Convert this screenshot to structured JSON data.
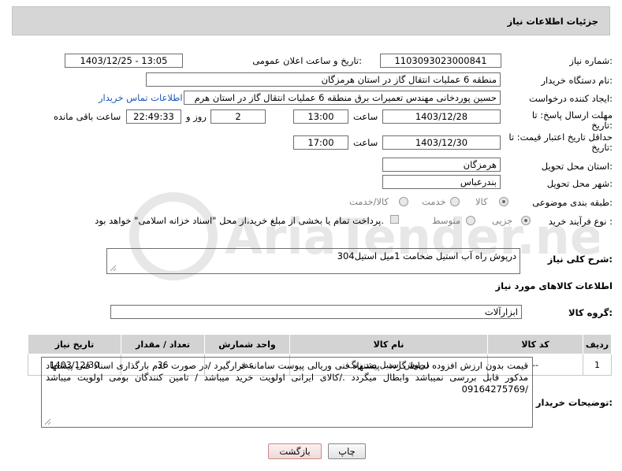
{
  "header": {
    "title": "جزئیات اطلاعات نیاز"
  },
  "form": {
    "need_number": {
      "label": "شماره نیاز:",
      "value": "1103093023000841"
    },
    "announce_datetime": {
      "label": "تاریخ و ساعت اعلان عمومی:",
      "value": "1403/12/25 - 13:05"
    },
    "buyer_org": {
      "label": "نام دستگاه خریدار:",
      "value": "منطقه 6 عملیات انتقال گاز در استان هرمزگان"
    },
    "requester": {
      "label": "ایجاد کننده درخواست:",
      "value": "حسین پوردخانی مهندس تعمیرات برق منطقه 6 عملیات انتقال گاز در استان هرم",
      "contact_link": "اطلاعات تماس خریدار"
    },
    "reply_deadline": {
      "label_line1": "مهلت ارسال پاسخ: تا",
      "label_line2": "تاریخ:",
      "date": "1403/12/28",
      "time_label": "ساعت",
      "time": "13:00",
      "days": "2",
      "days_label": "روز و",
      "remaining": "22:49:33",
      "remaining_label": "ساعت باقی مانده"
    },
    "validity_deadline": {
      "label_line1": "حداقل تاریخ اعتبار قیمت: تا",
      "label_line2": "تاریخ:",
      "date": "1403/12/30",
      "time_label": "ساعت",
      "time": "17:00"
    },
    "delivery_province": {
      "label": "استان محل تحویل:",
      "value": "هرمزگان"
    },
    "delivery_city": {
      "label": "شهر محل تحویل:",
      "value": "بندرعباس"
    },
    "category": {
      "label": "طبقه بندی موضوعی:",
      "options": [
        "کالا",
        "خدمت",
        "کالا/خدمت"
      ],
      "selected": "کالا"
    },
    "process_type": {
      "label": "نوع فرآیند خرید :",
      "options": [
        "جزیی",
        "متوسط"
      ],
      "selected": "جزیی",
      "note": "پرداخت تمام یا بخشی از مبلغ خرید،از محل \"اسناد خزانه اسلامی\" خواهد بود."
    },
    "general_description": {
      "label": "شرح کلی نیاز:",
      "value": "درپوش راه آب استیل ضخامت 1میل استیل304"
    }
  },
  "goods_section": {
    "title": "اطلاعات کالاهای مورد نیاز",
    "group_label": "گروه کالا:",
    "group_value": "ابزارآلات"
  },
  "items_table": {
    "columns": [
      "ردیف",
      "کد کالا",
      "نام کالا",
      "واحد شمارش",
      "تعداد / مقدار",
      "تاریخ نیاز"
    ],
    "rows": [
      [
        "1",
        "--",
        "درپوش استیل ضد زنگ",
        "عدد",
        "36",
        "1403/12/30"
      ]
    ]
  },
  "buyer_notes": {
    "label": "توضیحات خریدار:",
    "value": "قیمت بدون ارزش افزوده لحاظ گردد . پیشنهاد فنی وریالی پیوست سامانه قرارگیرد /در صورت عدم بارگذاری اسناد فنی پیشنهاد مذکور قابل بررسی نمیباشد وابطال میگردد ./کالای ایرانی اولویت خرید میباشد / تامین کنندگان بومی اولویت میباشد /09164275769"
  },
  "buttons": {
    "print": "چاپ",
    "back": "بازگشت"
  },
  "watermark_text": "AriaTender.net"
}
